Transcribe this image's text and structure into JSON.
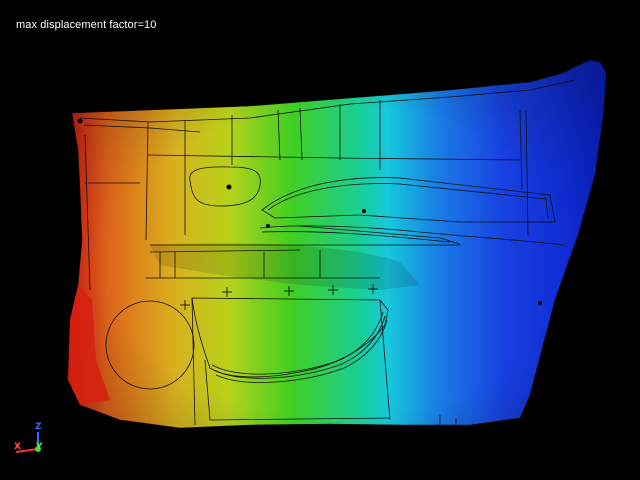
{
  "viewer": {
    "caption": "max displacement factor=10"
  },
  "triad": {
    "z_label": "Z",
    "x_label": "X",
    "y_label": "Y",
    "colors": {
      "x": "#ff2a2a",
      "y": "#33dd33",
      "z": "#3a6bff"
    }
  },
  "contour": {
    "colormap": [
      "#d11a1a",
      "#e67a10",
      "#e0d21a",
      "#2fcf2f",
      "#0fd0d6",
      "#1a4fe0",
      "#0a1fc8"
    ]
  }
}
